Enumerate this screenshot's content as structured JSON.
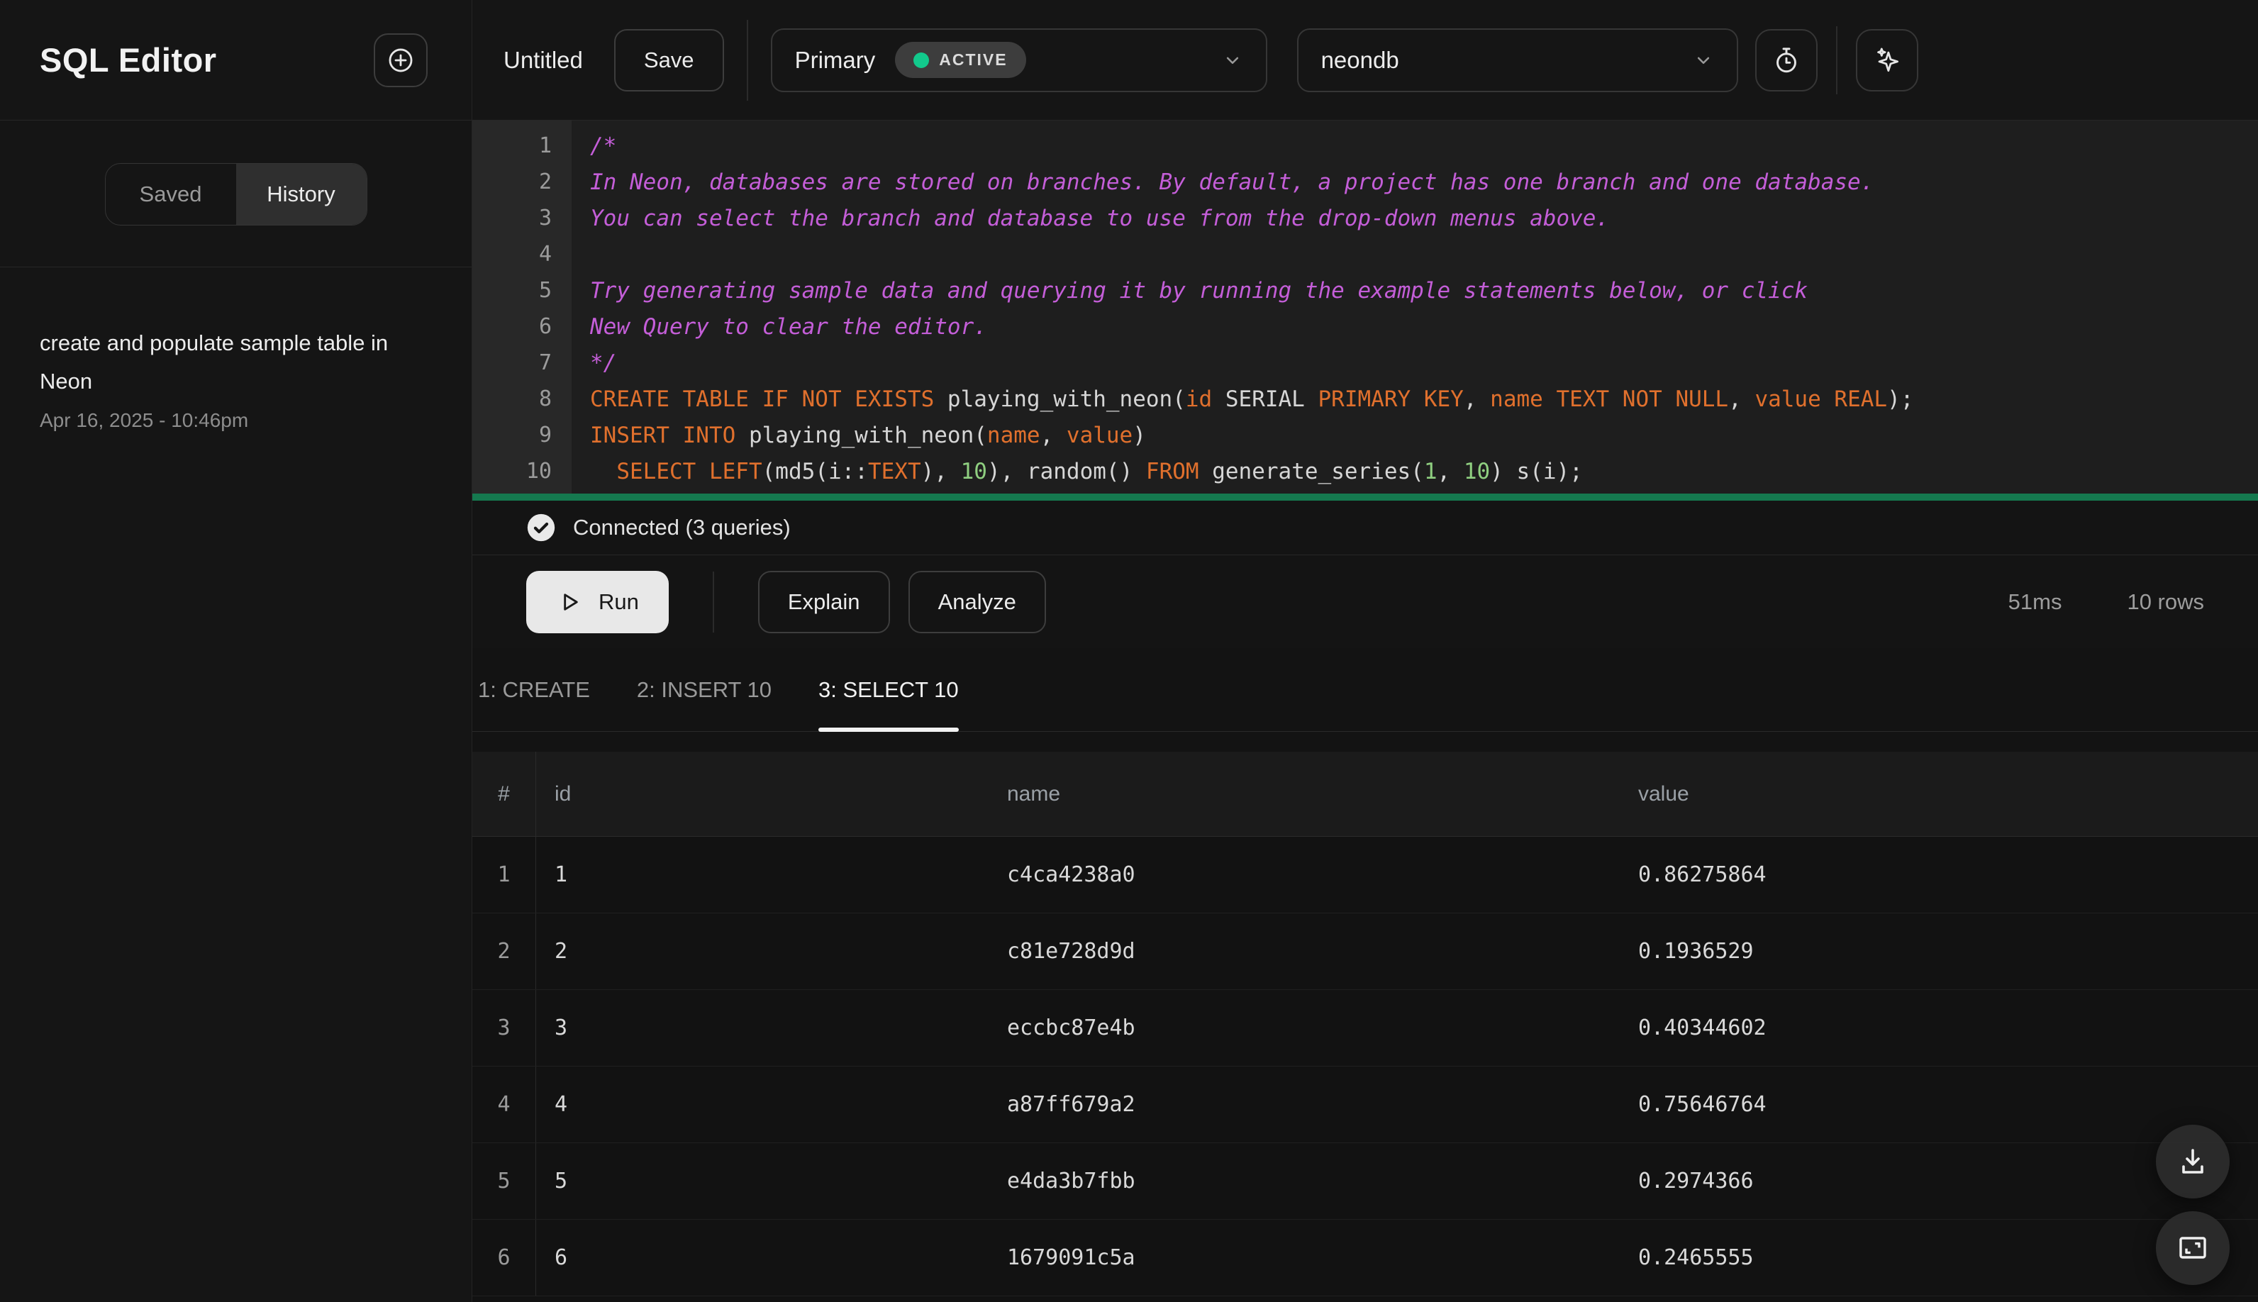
{
  "sidebar": {
    "title": "SQL Editor",
    "tabs": [
      {
        "label": "Saved",
        "active": false
      },
      {
        "label": "History",
        "active": true
      }
    ],
    "history": [
      {
        "title": "create and populate sample table in Neon",
        "date": "Apr 16, 2025 - 10:46pm"
      }
    ]
  },
  "topbar": {
    "query_name": "Untitled",
    "save_label": "Save",
    "branch": {
      "name": "Primary",
      "status": "ACTIVE"
    },
    "database": "neondb"
  },
  "editor": {
    "lines": [
      [
        {
          "c": "comment",
          "t": "/*"
        }
      ],
      [
        {
          "c": "comment",
          "t": "In Neon, databases are stored on branches. By default, a project has one branch and one database."
        }
      ],
      [
        {
          "c": "comment",
          "t": "You can select the branch and database to use from the drop-down menus above."
        }
      ],
      [],
      [
        {
          "c": "comment",
          "t": "Try generating sample data and querying it by running the example statements below, or click"
        }
      ],
      [
        {
          "c": "comment",
          "t": "New Query to clear the editor."
        }
      ],
      [
        {
          "c": "comment",
          "t": "*/"
        }
      ],
      [
        {
          "c": "kw",
          "t": "CREATE TABLE IF NOT EXISTS"
        },
        {
          "c": "pl",
          "t": " playing_with_neon("
        },
        {
          "c": "kw",
          "t": "id"
        },
        {
          "c": "pl",
          "t": " SERIAL "
        },
        {
          "c": "kw",
          "t": "PRIMARY KEY"
        },
        {
          "c": "pl",
          "t": ", "
        },
        {
          "c": "kw",
          "t": "name TEXT NOT NULL"
        },
        {
          "c": "pl",
          "t": ", "
        },
        {
          "c": "kw",
          "t": "value REAL"
        },
        {
          "c": "pl",
          "t": ");"
        }
      ],
      [
        {
          "c": "kw",
          "t": "INSERT INTO"
        },
        {
          "c": "pl",
          "t": " playing_with_neon("
        },
        {
          "c": "kw",
          "t": "name"
        },
        {
          "c": "pl",
          "t": ", "
        },
        {
          "c": "kw",
          "t": "value"
        },
        {
          "c": "pl",
          "t": ")"
        }
      ],
      [
        {
          "c": "pl",
          "t": "  "
        },
        {
          "c": "kw",
          "t": "SELECT LEFT"
        },
        {
          "c": "pl",
          "t": "(md5(i::"
        },
        {
          "c": "kw",
          "t": "TEXT"
        },
        {
          "c": "pl",
          "t": "), "
        },
        {
          "c": "num",
          "t": "10"
        },
        {
          "c": "pl",
          "t": "), random() "
        },
        {
          "c": "kw",
          "t": "FROM"
        },
        {
          "c": "pl",
          "t": " generate_series("
        },
        {
          "c": "num",
          "t": "1"
        },
        {
          "c": "pl",
          "t": ", "
        },
        {
          "c": "num",
          "t": "10"
        },
        {
          "c": "pl",
          "t": ") s(i);"
        }
      ]
    ]
  },
  "status": {
    "connected": "Connected (3 queries)"
  },
  "actions": {
    "run": "Run",
    "explain": "Explain",
    "analyze": "Analyze",
    "duration": "51ms",
    "row_count": "10 rows"
  },
  "result_tabs": [
    {
      "label": "1: CREATE",
      "active": false
    },
    {
      "label": "2: INSERT 10",
      "active": false
    },
    {
      "label": "3: SELECT 10",
      "active": true
    }
  ],
  "results": {
    "columns": [
      "#",
      "id",
      "name",
      "value"
    ],
    "rows": [
      [
        "1",
        "1",
        "c4ca4238a0",
        "0.86275864"
      ],
      [
        "2",
        "2",
        "c81e728d9d",
        "0.1936529"
      ],
      [
        "3",
        "3",
        "eccbc87e4b",
        "0.40344602"
      ],
      [
        "4",
        "4",
        "a87ff679a2",
        "0.75646764"
      ],
      [
        "5",
        "5",
        "e4da3b7fbb",
        "0.2974366"
      ],
      [
        "6",
        "6",
        "1679091c5a",
        "0.2465555"
      ]
    ]
  },
  "icons": {
    "new_query": "plus-circle-icon",
    "branch_select": "chevron-down-icon",
    "database_select": "chevron-down-icon",
    "query_history": "stopwatch-icon",
    "ai_assist": "sparkles-icon",
    "connection_status": "check-circle-icon",
    "run": "play-icon",
    "export_results": "download-icon",
    "fullscreen_results": "expand-icon"
  },
  "colors": {
    "accent_green": "#12c98c",
    "progress_green": "#15794f",
    "keyword_orange": "#e0702d",
    "comment_magenta": "#c45ed8",
    "number_green": "#8fcf80",
    "run_button_bg": "#e8e8e8",
    "background": "#131313"
  }
}
